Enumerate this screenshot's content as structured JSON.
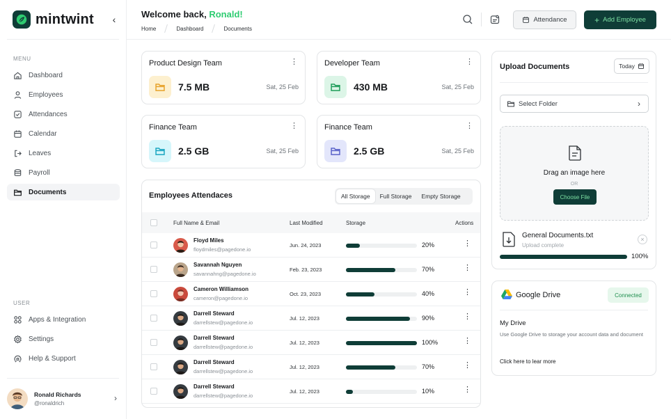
{
  "brand": {
    "name": "mintwint",
    "accent": "#0f3d37",
    "highlight": "#2ecc71"
  },
  "sidebar": {
    "menu_label": "MENU",
    "items": [
      {
        "label": "Dashboard",
        "icon": "home-icon"
      },
      {
        "label": "Employees",
        "icon": "user-icon"
      },
      {
        "label": "Attendances",
        "icon": "checkbox-icon"
      },
      {
        "label": "Calendar",
        "icon": "calendar-icon"
      },
      {
        "label": "Leaves",
        "icon": "logout-icon"
      },
      {
        "label": "Payroll",
        "icon": "database-icon"
      },
      {
        "label": "Documents",
        "icon": "folder-icon",
        "active": true
      }
    ],
    "user_label": "USER",
    "user_items": [
      {
        "label": "Apps & Integration",
        "icon": "apps-icon"
      },
      {
        "label": "Settings",
        "icon": "gear-icon"
      },
      {
        "label": "Help & Support",
        "icon": "help-icon"
      }
    ],
    "profile": {
      "name": "Ronald Richards",
      "handle": "@ronaldrich"
    }
  },
  "header": {
    "welcome": "Welcome back,",
    "user_name": "Ronald!",
    "breadcrumb": [
      "Home",
      "Dashboard",
      "Documents"
    ],
    "attendance_label": "Attendance",
    "add_employee_label": "Add Employee"
  },
  "teams": [
    {
      "name": "Product Design Team",
      "size": "7.5 MB",
      "date": "Sat, 25 Feb",
      "color": "#fdf0cf",
      "icon_color": "#e7a22a"
    },
    {
      "name": "Developer Team",
      "size": "430 MB",
      "date": "Sat, 25 Feb",
      "color": "#dcf5e7",
      "icon_color": "#1f9d5a"
    },
    {
      "name": "Finance Team",
      "size": "2.5 GB",
      "date": "Sat, 25 Feb",
      "color": "#d6f6fb",
      "icon_color": "#1aa6c1"
    },
    {
      "name": "Finance Team",
      "size": "2.5 GB",
      "date": "Sat, 25 Feb",
      "color": "#e3e6fb",
      "icon_color": "#5b63c9"
    }
  ],
  "attendance_table": {
    "title": "Employees Attendaces",
    "filters": [
      "All Storage",
      "Full Storage",
      "Empty Storage"
    ],
    "selected_filter": "All Storage",
    "columns": [
      "Full Name & Email",
      "Last Modified",
      "Storage",
      "Actions"
    ],
    "rows": [
      {
        "name": "Floyd Miles",
        "email": "floydmiles@pagedone.io",
        "date": "Jun. 24, 2023",
        "storage": 20,
        "pct": "20%"
      },
      {
        "name": "Savannah Nguyen",
        "email": "savannahng@pagedone.io",
        "date": "Feb. 23, 2023",
        "storage": 70,
        "pct": "70%"
      },
      {
        "name": "Cameron Williamson",
        "email": "cameron@pagedone.io",
        "date": "Oct. 23, 2023",
        "storage": 40,
        "pct": "40%"
      },
      {
        "name": "Darrell Steward",
        "email": "darrellstew@pagedone.io",
        "date": "Jul. 12, 2023",
        "storage": 90,
        "pct": "90%"
      },
      {
        "name": "Darrell Steward",
        "email": "darrellstew@pagedone.io",
        "date": "Jul. 12, 2023",
        "storage": 100,
        "pct": "100%"
      },
      {
        "name": "Darrell Steward",
        "email": "darrellstew@pagedone.io",
        "date": "Jul. 12, 2023",
        "storage": 70,
        "pct": "70%"
      },
      {
        "name": "Darrell Steward",
        "email": "darrellstew@pagedone.io",
        "date": "Jul. 12, 2023",
        "storage": 10,
        "pct": "10%"
      }
    ]
  },
  "upload": {
    "title": "Upload Documents",
    "date_filter": "Today",
    "folder_placeholder": "Select Folder",
    "drop_text": "Drag an image here",
    "or_text": "OR",
    "choose_label": "Choose File",
    "file_name": "General Documents.txt",
    "file_status": "Upload complete",
    "progress": 100,
    "progress_label": "100%"
  },
  "google_drive": {
    "title": "Google Drive",
    "status": "Connected",
    "subtitle": "My Drive",
    "description": "Use Google Drive to storage your account data and document",
    "link": "Click here to lear more"
  }
}
